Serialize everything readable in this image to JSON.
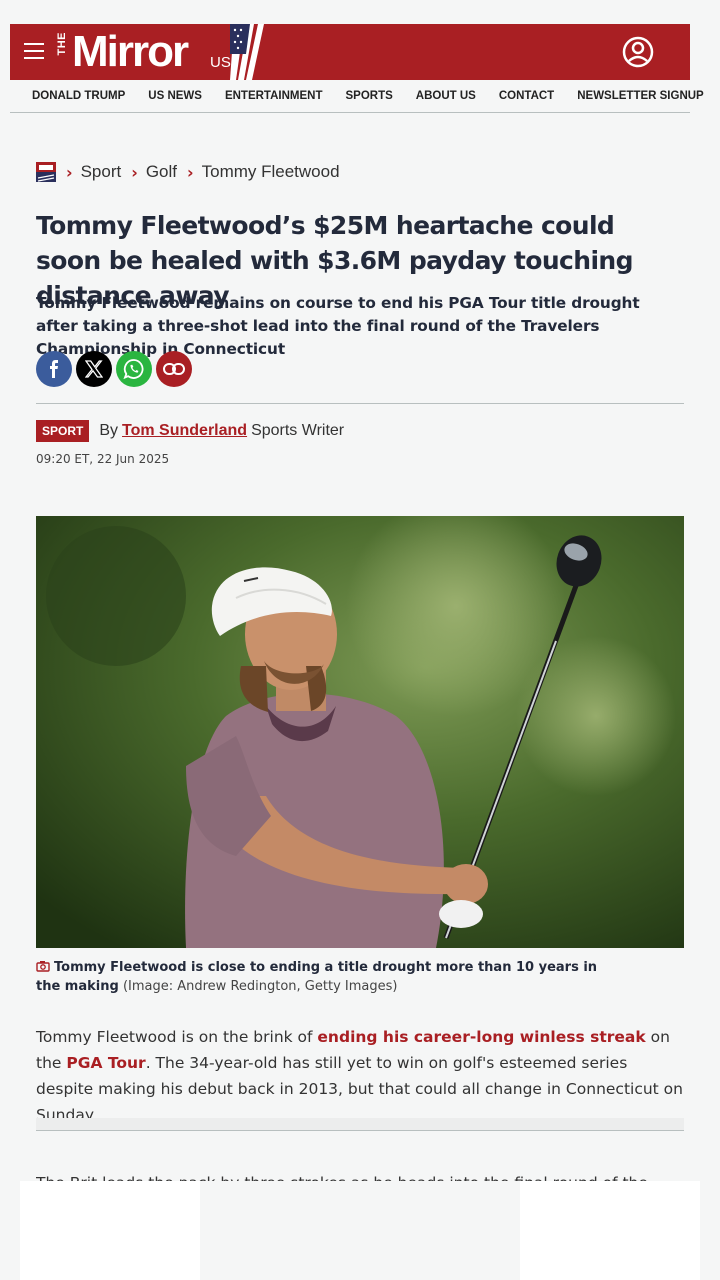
{
  "brand": {
    "the": "THE",
    "name": "Mirror",
    "edition": "US",
    "accent_color": "#a91f23"
  },
  "header": {
    "menu_icon": "hamburger-icon",
    "account_icon": "user-account-icon"
  },
  "nav": {
    "items": [
      "DONALD TRUMP",
      "US NEWS",
      "ENTERTAINMENT",
      "SPORTS",
      "ABOUT US",
      "CONTACT",
      "NEWSLETTER SIGNUP"
    ]
  },
  "breadcrumb": {
    "items": [
      "Sport",
      "Golf",
      "Tommy Fleetwood"
    ]
  },
  "article": {
    "headline": "Tommy Fleetwood’s $25M heartache could soon be healed with $3.6M payday touching distance away",
    "standfirst": "Tommy Fleetwood remains on course to end his PGA Tour title drought after taking a three-shot lead into the final round of the Travelers Championship in Connecticut",
    "section_badge": "SPORT",
    "by": "By",
    "author": "Tom Sunderland",
    "author_role": "Sports Writer",
    "timestamp": "09:20 ET, 22 Jun 2025",
    "caption_main": "Tommy Fleetwood is close to ending a title drought more than 10 years in the making",
    "caption_credit": "(Image: Andrew Redington, Getty Images)",
    "para1": {
      "t1": "Tommy Fleetwood is on the brink of ",
      "link1": "ending his career-long winless streak",
      "t2": " on the ",
      "link2": "PGA Tour",
      "t3": ". The 34-year-old has still yet to win on golf's esteemed series despite making his debut back in 2013, but that could all change in Connecticut on Sunday."
    },
    "para2": "The Brit leads the pack by three strokes as he heads into the final round of the"
  },
  "share": {
    "icons": [
      "facebook-icon",
      "x-icon",
      "whatsapp-icon",
      "link-icon"
    ]
  }
}
